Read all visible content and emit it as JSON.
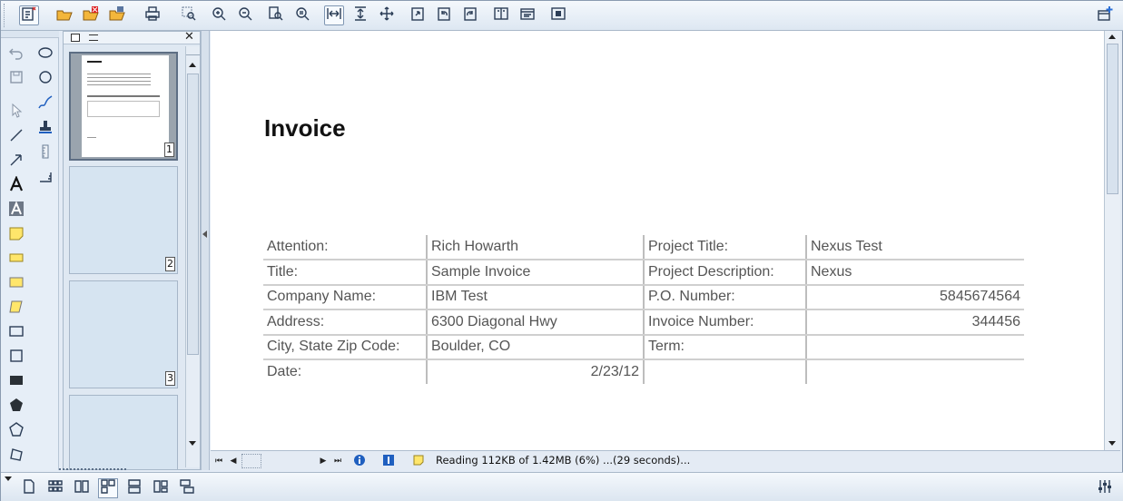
{
  "document": {
    "title": "Invoice",
    "rows": [
      {
        "l1": "Attention:",
        "v1": "Rich Howarth",
        "l2": "Project Title:",
        "v2": "Nexus Test"
      },
      {
        "l1": "Title:",
        "v1": "Sample Invoice",
        "l2": "Project Description:",
        "v2": "Nexus"
      },
      {
        "l1": "Company Name:",
        "v1": "IBM Test",
        "l2": "P.O. Number:",
        "v2": "5845674564"
      },
      {
        "l1": "Address:",
        "v1": "6300 Diagonal Hwy",
        "l2": "Invoice Number:",
        "v2": "344456"
      },
      {
        "l1": "City, State Zip Code:",
        "v1": "Boulder, CO",
        "l2": "Term:",
        "v2": ""
      },
      {
        "l1": "Date:",
        "v1": "2/23/12",
        "l2": "",
        "v2": ""
      }
    ]
  },
  "thumbnails": {
    "pages": [
      "1",
      "2",
      "3"
    ]
  },
  "status": {
    "text": "Reading 112KB of 1.42MB (6%) ...(29 seconds)..."
  },
  "icons": {
    "top_toolbar": [
      "settings-icon",
      "open-icon",
      "close-file-icon",
      "save-icon",
      "print-icon",
      "zoom-region-icon",
      "zoom-in-icon",
      "zoom-out-icon",
      "zoom-to-fit-icon",
      "zoom-actual-icon",
      "fit-width-icon",
      "fit-height-icon",
      "pan-icon",
      "rotate-icon",
      "rotate-left-icon",
      "rotate-right-icon",
      "page-setup-icon",
      "properties-icon",
      "snapshot-icon",
      "new-window-icon"
    ],
    "bottom_toolbar": [
      "single-page-icon",
      "grid-pages-icon",
      "facing-pages-icon",
      "continuous-icon",
      "two-up-icon",
      "book-icon",
      "cascade-icon",
      "settings-sliders-icon"
    ]
  },
  "colors": {
    "toolbar_bg": "#dde7f2",
    "panel_bg": "#dfe8f2",
    "note_yellow": "#ffe66b"
  }
}
